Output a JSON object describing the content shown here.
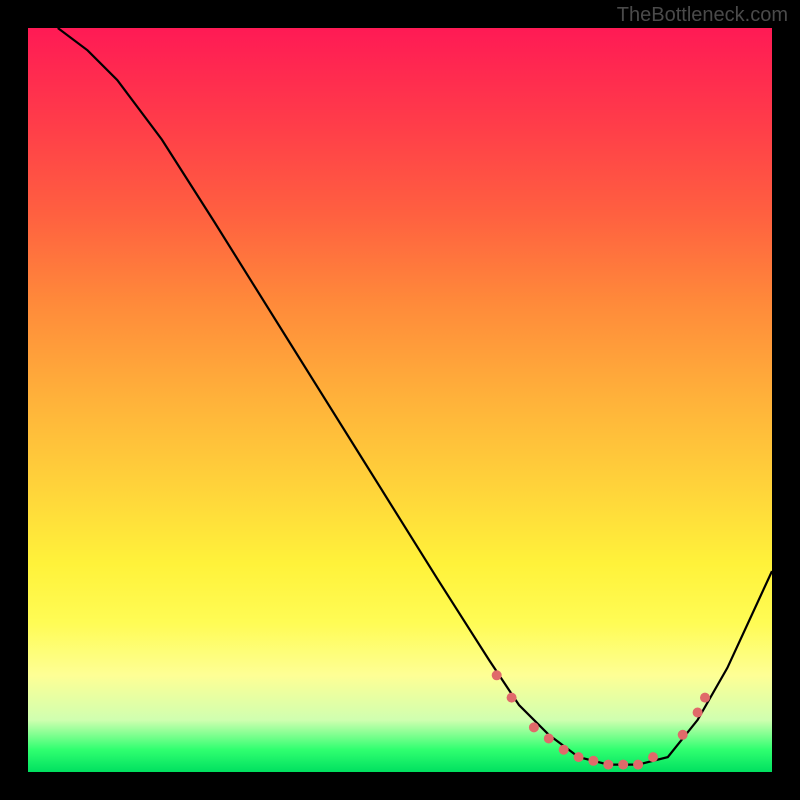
{
  "watermark": "TheBottleneck.com",
  "chart_data": {
    "type": "line",
    "title": "",
    "xlabel": "",
    "ylabel": "",
    "xlim": [
      0,
      100
    ],
    "ylim": [
      0,
      100
    ],
    "series": [
      {
        "name": "bottleneck-curve",
        "x": [
          4,
          8,
          12,
          18,
          25,
          35,
          45,
          55,
          62,
          66,
          70,
          74,
          78,
          82,
          86,
          90,
          94,
          100
        ],
        "y": [
          100,
          97,
          93,
          85,
          74,
          58,
          42,
          26,
          15,
          9,
          5,
          2,
          1,
          1,
          2,
          7,
          14,
          27
        ]
      }
    ],
    "markers": {
      "name": "highlight-dots",
      "color": "#e06a6a",
      "x": [
        63,
        65,
        68,
        70,
        72,
        74,
        76,
        78,
        80,
        82,
        84,
        88,
        90,
        91
      ],
      "y": [
        13,
        10,
        6,
        4.5,
        3,
        2,
        1.5,
        1,
        1,
        1,
        2,
        5,
        8,
        10
      ]
    },
    "background": "rainbow-vertical-gradient",
    "grid": false
  }
}
